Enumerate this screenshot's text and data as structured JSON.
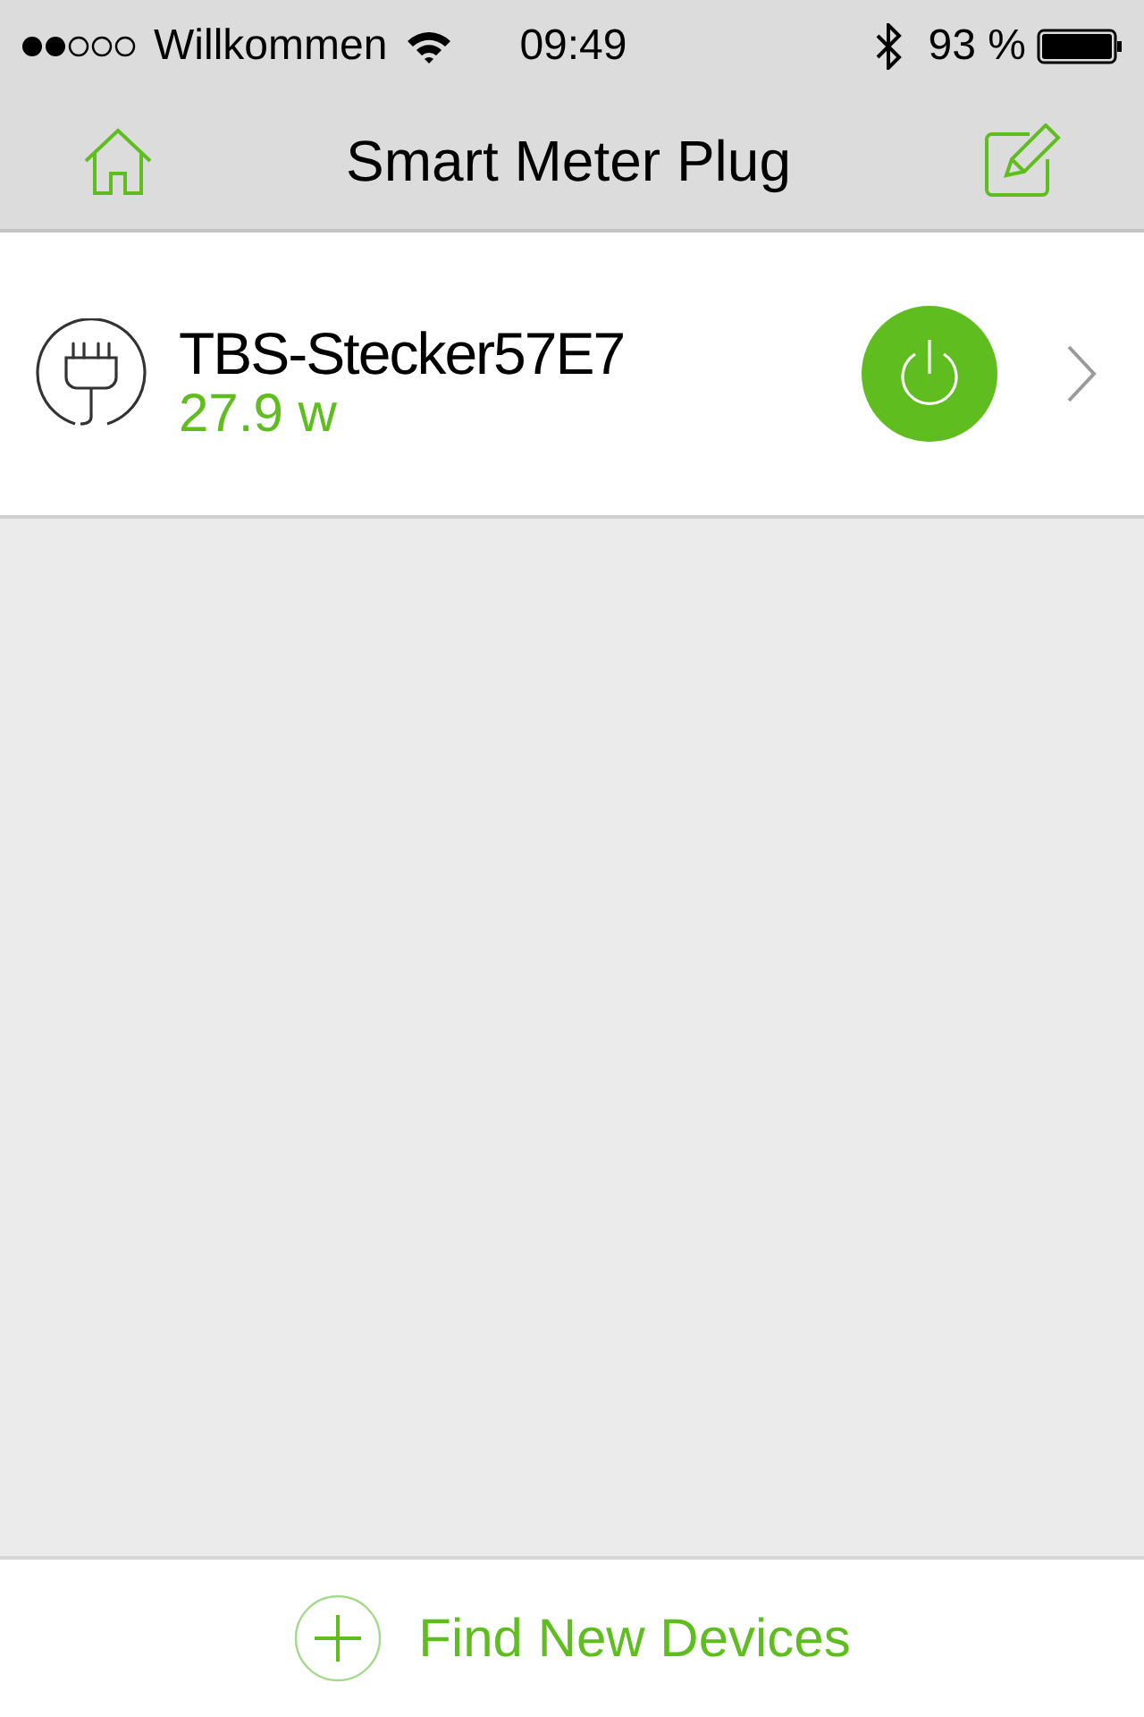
{
  "status_bar": {
    "carrier": "Willkommen",
    "time": "09:49",
    "battery": "93 %"
  },
  "nav_bar": {
    "title": "Smart Meter Plug"
  },
  "devices": [
    {
      "name": "TBS-Stecker57E7",
      "power": "27.9 w",
      "on": true
    }
  ],
  "footer": {
    "label": "Find New Devices"
  }
}
